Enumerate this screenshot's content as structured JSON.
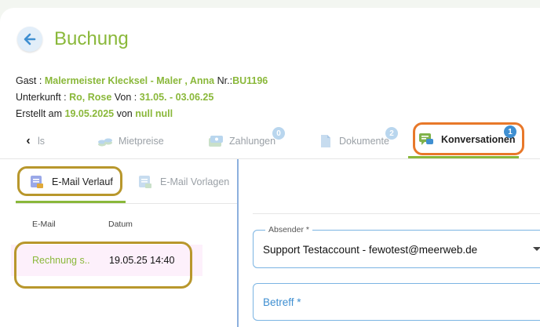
{
  "header": {
    "title": "Buchung"
  },
  "booking": {
    "guest_label": "Gast :",
    "guest_name": "Malermeister Klecksel - Maler , Anna",
    "nr_label": "Nr.:",
    "nr_value": "BU1196",
    "unit_label": "Unterkunft :",
    "unit_value": "Ro, Rose",
    "from_label": "Von :",
    "date_range": "31.05. - 03.06.25",
    "created_label": "Erstellt am",
    "created_date": "19.05.2025",
    "by_label": "von",
    "created_by": "null null"
  },
  "tabs": [
    {
      "label": "ls",
      "icon": "partial-tab"
    },
    {
      "label": "Mietpreise",
      "icon": "coins-icon"
    },
    {
      "label": "Zahlungen",
      "icon": "money-icon",
      "badge": "0"
    },
    {
      "label": "Dokumente",
      "icon": "document-icon",
      "badge": "2"
    },
    {
      "label": "Konversationen",
      "icon": "chat-icon",
      "badge": "1",
      "active": true
    }
  ],
  "subtabs": [
    {
      "label": "E-Mail Verlauf",
      "active": true,
      "icon": "email-history-icon"
    },
    {
      "label": "E-Mail Vorlagen",
      "active": false,
      "icon": "email-template-icon"
    }
  ],
  "table": {
    "columns": [
      "E-Mail",
      "Datum"
    ],
    "rows": [
      {
        "email": "Rechnung s..",
        "date": "19.05.25 14:40"
      }
    ]
  },
  "form": {
    "sender_label": "Absender *",
    "sender_value": "Support Testaccount - fewotest@meerweb.de",
    "subject_placeholder": "Betreff *"
  },
  "colors": {
    "accent_green": "#8ab83a",
    "accent_blue": "#3f8fd1",
    "highlight_outline_orange": "#e8782a",
    "highlight_outline_gold": "#b8972c"
  }
}
